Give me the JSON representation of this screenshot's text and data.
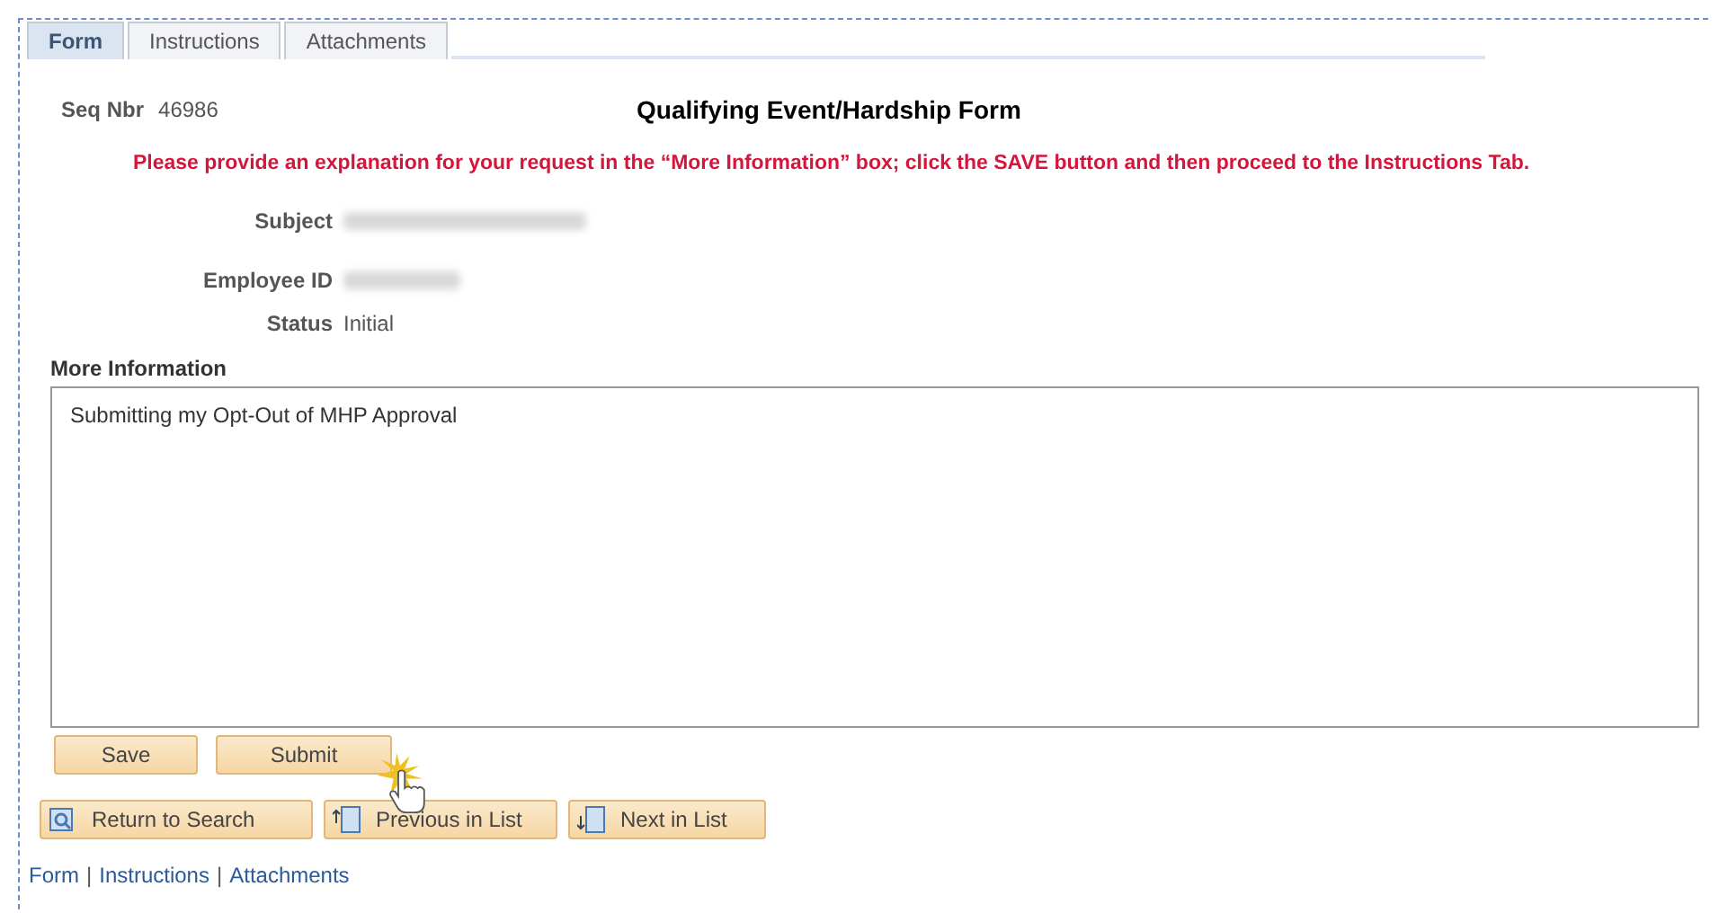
{
  "tabs": [
    {
      "label": "Form",
      "selected": true
    },
    {
      "label": "Instructions",
      "selected": false
    },
    {
      "label": "Attachments",
      "selected": false
    }
  ],
  "seq_nbr": {
    "label": "Seq Nbr",
    "value": "46986"
  },
  "title": "Qualifying Event/Hardship Form",
  "notice": "Please provide an explanation for your request in the “More Information” box; click the SAVE button and then proceed to the Instructions Tab.",
  "fields": [
    {
      "label": "Subject",
      "kind": "blurred"
    },
    {
      "label": "Employee ID",
      "kind": "blurred"
    },
    {
      "label": "Status",
      "kind": "text",
      "value": "Initial"
    }
  ],
  "more_information": {
    "label": "More Information",
    "value": "Submitting my Opt-Out of MHP Approval"
  },
  "action_buttons": [
    "Save",
    "Submit"
  ],
  "nav_buttons": [
    {
      "label": "Return to Search",
      "kind": "search"
    },
    {
      "label": "Previous in List",
      "kind": "previous"
    },
    {
      "label": "Next in List",
      "kind": "next"
    }
  ],
  "footer_links": [
    "Form",
    "Instructions",
    "Attachments"
  ],
  "footer_separator": "|"
}
